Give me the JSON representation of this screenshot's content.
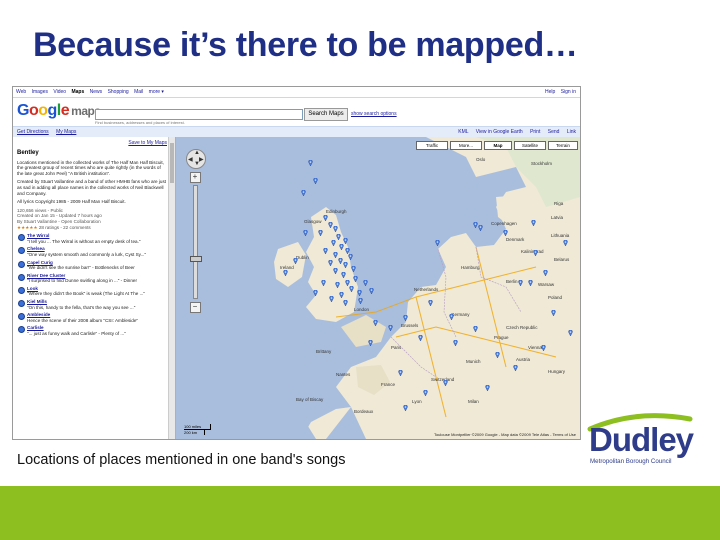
{
  "slide": {
    "title": "Because it’s there to be mapped…",
    "caption": "Locations of places mentioned in one band's songs"
  },
  "brand": {
    "logo_word": "Dudley",
    "logo_sub": "Metropolitan Borough Council",
    "title_color": "#1f2f86",
    "accent_green": "#8dbf20",
    "logo_blue": "#2e3c8a"
  },
  "screenshot": {
    "gbar": {
      "nav": [
        "Web",
        "Images",
        "Video",
        "Maps",
        "News",
        "Shopping",
        "Mail",
        "more ▾"
      ],
      "active": "Maps",
      "right": [
        "Help",
        "Sign in"
      ]
    },
    "logo": {
      "google": "Google",
      "maps": "maps"
    },
    "search": {
      "button": "Search Maps",
      "options": "show search options",
      "hint": "Find businesses, addresses and places of interest."
    },
    "toolbar": {
      "left": [
        "Get Directions",
        "My Maps"
      ],
      "right": [
        "KML",
        "View in Google Earth",
        "Print",
        "Send",
        "Link"
      ]
    },
    "sidebar": {
      "view_link": "Save to My Maps",
      "title": "Bentley",
      "description": "Locations mentioned in the collected works of The Half Man Half Biscuit, the greatest group of recent times who are quite rightly (in the words of the late great John Peel) \"A British institution\".",
      "created": "Created by Stuart Vallantine and a band of other HMHB fans who are just as sad in adding all place names in the collected works of Neil Blackwell and Company.",
      "copyright": "All lyrics Copyright 1985 - 2009 Half Man Half Biscuit.",
      "meta": [
        "120,656 views - Public",
        "Created on Jan 15 - Updated 7 hours ago",
        "By Stuart Vallantine - Open Collaboration"
      ],
      "stars": "★★★★★",
      "ratings": "28 ratings - 22 comments",
      "items": [
        {
          "name": "The Wirral",
          "text": "\"I tell you ... The Wirral is without an empty desk of tea.\""
        },
        {
          "name": "Chelsea",
          "text": "\"One way system smooth and commonly a lurk, Cyst Sy...\""
        },
        {
          "name": "Capel Curig",
          "text": "\"We didn't see the sunrise bar!\" - Bottlenecks of Beer"
        },
        {
          "name": "River Dee Cluster",
          "text": "\"I surprised to find Dunne swirling along in ...\" - Dinner"
        },
        {
          "name": "Look",
          "text": "\"Where they didn't the Book\" is weak (The Light At The ...\""
        },
        {
          "name": "Kiel Mills",
          "text": "\"On this, handy to the fella, that's the way you see ...\""
        },
        {
          "name": "Ambleside",
          "text": "Hence the scene of their 2008 album \"CSI: Ambleside\""
        },
        {
          "name": "Carlisle",
          "text": "\"... just as funny walk and Carlisle\" - Plenty of ...\""
        }
      ]
    },
    "map": {
      "types": [
        "Traffic",
        "More...",
        "Map",
        "Satellite",
        "Terrain"
      ],
      "scale": [
        "100 miles",
        "200 km"
      ],
      "copyright": "Toulouse  Montpellier  ©2009 Google - Map data ©2009 Tele Atlas - Terms of Use",
      "labels": {
        "denmark": "Denmark",
        "hamburg": "Hamburg",
        "berlin": "Berlin",
        "germany": "Germany",
        "poland": "Poland",
        "czech": "Czech Republic",
        "austria": "Austria",
        "france": "France",
        "paris": "Paris",
        "london": "London",
        "ireland": "Ireland",
        "dublin": "Dublin",
        "netherlands": "Netherlands",
        "switzerland": "Switzerland",
        "lithuania": "Lithuania",
        "latvia": "Latvia",
        "belarus": "Belarus",
        "warsaw": "Warsaw",
        "prague": "Prague",
        "munich": "Munich",
        "vienna": "Vienna",
        "hungary": "Hungary",
        "bordeaux": "Bordeaux",
        "lyon": "Lyon",
        "milan": "Milan",
        "edinburgh": "Edinburgh",
        "glasgow": "Glasgow",
        "copenhagen": "Copenhagen",
        "oslo": "Oslo",
        "stockholm": "Stockholm",
        "riga": "Riga",
        "kaliningrad": "Kaliningrad",
        "brussels": "Brussels",
        "bay": "Bay of Biscay",
        "nantes": "Nantes",
        "brittany": "Brittany"
      }
    }
  }
}
